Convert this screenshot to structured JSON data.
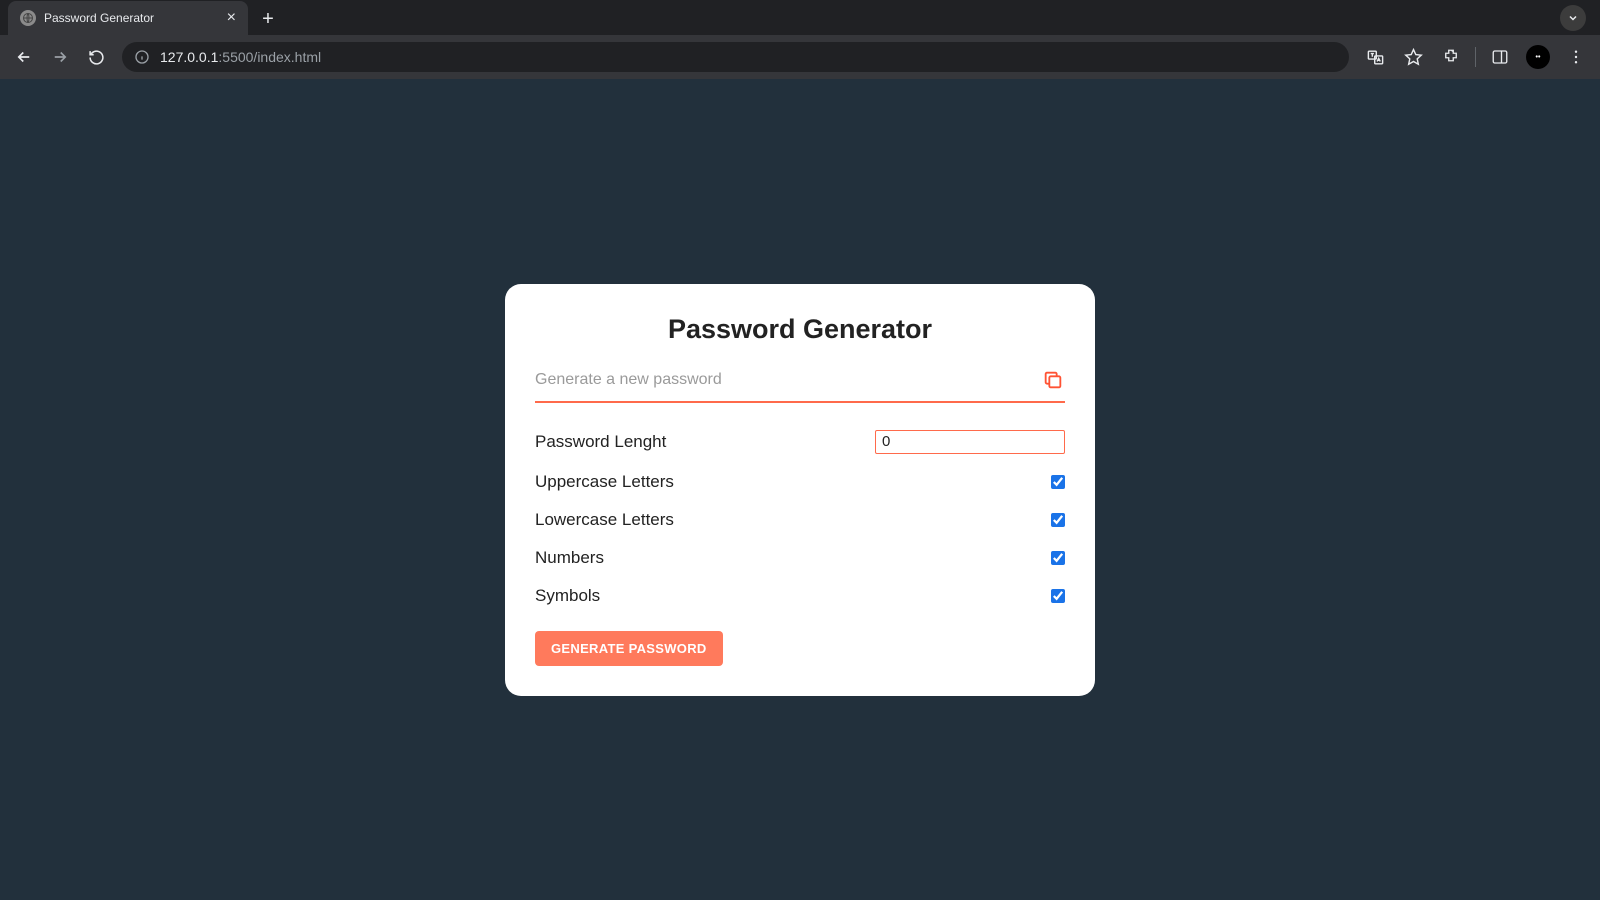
{
  "browser": {
    "tab_title": "Password Generator",
    "url_host": "127.0.0.1",
    "url_port_path": ":5500/index.html"
  },
  "card": {
    "title": "Password Generator",
    "password_placeholder": "Generate a new password",
    "password_value": "",
    "length_label": "Password Lenght",
    "length_value": "0",
    "options": {
      "uppercase_label": "Uppercase Letters",
      "uppercase_checked": true,
      "lowercase_label": "Lowercase Letters",
      "lowercase_checked": true,
      "numbers_label": "Numbers",
      "numbers_checked": true,
      "symbols_label": "Symbols",
      "symbols_checked": true
    },
    "generate_label": "GENERATE PASSWORD"
  }
}
